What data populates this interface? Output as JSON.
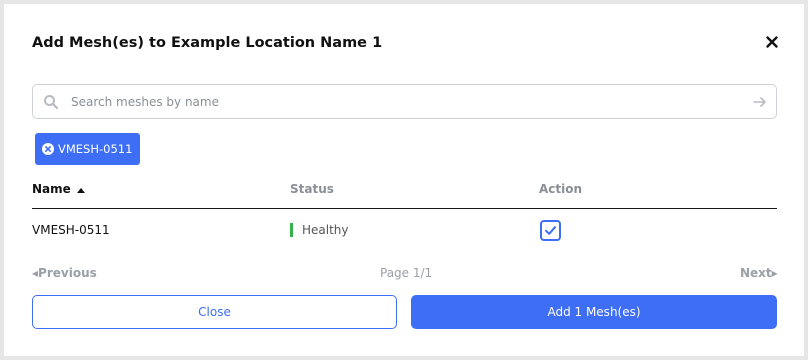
{
  "modal": {
    "title": "Add Mesh(es) to Example Location Name 1",
    "close_icon": "close-icon"
  },
  "search": {
    "placeholder": "Search meshes by name",
    "value": "",
    "icon": "search-icon",
    "submit_icon": "arrow-right-icon"
  },
  "selected_chips": [
    {
      "label": "VMESH-0511",
      "icon": "remove-circle-icon"
    }
  ],
  "table": {
    "columns": [
      {
        "label": "Name",
        "sort": "ascending"
      },
      {
        "label": "Status"
      },
      {
        "label": "Action"
      }
    ],
    "rows": [
      {
        "name": "VMESH-0511",
        "status": "Healthy",
        "status_color": "#33b24a",
        "selected": true
      }
    ]
  },
  "pagination": {
    "previous_label": "Previous",
    "page_label": "Page 1/1",
    "next_label": "Next"
  },
  "footer": {
    "close_label": "Close",
    "add_label": "Add 1 Mesh(es)"
  },
  "colors": {
    "accent": "#3d6ef5",
    "healthy": "#33b24a"
  }
}
